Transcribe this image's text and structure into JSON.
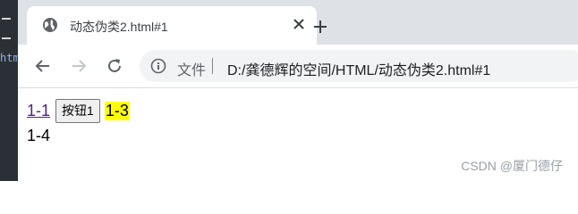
{
  "editor_stub": {
    "text": "htm"
  },
  "tab": {
    "title": "动态伪类2.html#1",
    "favicon": "globe-icon",
    "close": "close-icon"
  },
  "new_tab": {
    "icon": "plus-icon"
  },
  "toolbar": {
    "back_icon": "arrow-left-icon",
    "forward_icon": "arrow-right-icon",
    "reload_icon": "reload-icon"
  },
  "omnibox": {
    "security_icon": "info-icon",
    "security_label": "文件",
    "url": "D:/龚德辉的空间/HTML/动态伪类2.html#1"
  },
  "page": {
    "link_label": "1-1",
    "button_label": "按钮1",
    "highlight_label": "1-3",
    "line2_label": "1-4"
  },
  "watermark": {
    "text": "CSDN @厦门德仔"
  },
  "colors": {
    "tabstrip": "#dee1e6",
    "visited_link": "#551a8b",
    "highlight": "#ffff00",
    "omnibox_bg": "#f1f3f4"
  }
}
